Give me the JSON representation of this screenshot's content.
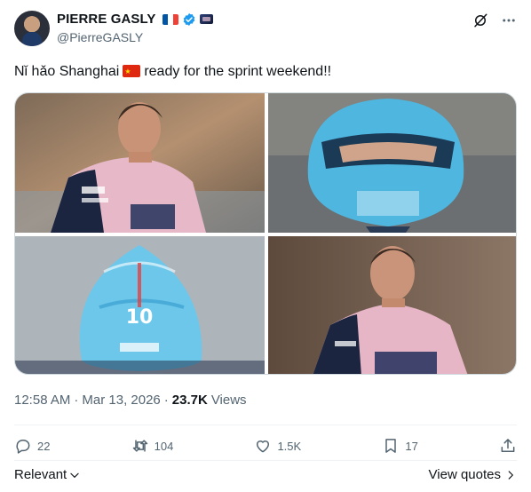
{
  "author": {
    "display_name": "PIERRE GASLY",
    "handle": "@PierreGASLY"
  },
  "tweet": {
    "text_before_flag": "Nǐ hǎo Shanghai",
    "text_after_flag": "ready for the sprint weekend!!"
  },
  "photos": [
    {
      "name": "driver-portrait-pink-suit"
    },
    {
      "name": "driver-in-blue-helmet"
    },
    {
      "name": "helmet-rear-number-10",
      "number": "10"
    },
    {
      "name": "driver-smiling-portrait"
    }
  ],
  "meta": {
    "time": "12:58 AM",
    "separator": "·",
    "date": "Mar 13, 2026",
    "views_count": "23.7K",
    "views_label": "Views"
  },
  "actions": {
    "replies": "22",
    "reposts": "104",
    "likes": "1.5K",
    "bookmarks": "17"
  },
  "footer": {
    "sort_label": "Relevant",
    "view_quotes_label": "View quotes"
  },
  "colors": {
    "text": "#0f1419",
    "secondary": "#536471",
    "verified": "#1d9bf0"
  }
}
